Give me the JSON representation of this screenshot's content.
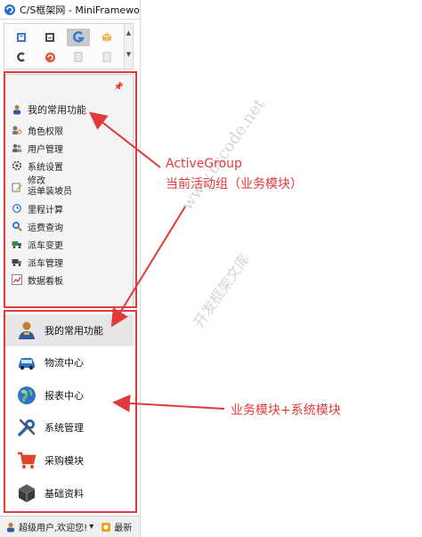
{
  "window": {
    "title": "C/S框架网 - MiniFramewo"
  },
  "toolbar": {
    "row1": [
      "doc-icon",
      "doc-icon",
      "g-logo-icon",
      "box-icon"
    ],
    "row2": [
      "c-logo-icon",
      "red-circle-icon",
      "page-icon",
      "page-icon"
    ],
    "scroll_up": "▲",
    "scroll_down": "▼"
  },
  "active_group": {
    "pin": "📌",
    "title": "我的常用功能",
    "items": [
      {
        "label": "角色权限",
        "icon": "key-user-icon"
      },
      {
        "label": "用户管理",
        "icon": "users-icon"
      },
      {
        "label": "系统设置",
        "icon": "gear-icon"
      },
      {
        "label_line1": "修改",
        "label_line2": "运单装坡员",
        "icon": "edit-icon"
      },
      {
        "label": "里程计算",
        "icon": "clock-icon"
      },
      {
        "label": "运费查询",
        "icon": "search-icon"
      },
      {
        "label": "派车变更",
        "icon": "truck-icon"
      },
      {
        "label": "派车管理",
        "icon": "truck-icon"
      },
      {
        "label": "数据看板",
        "icon": "chart-icon"
      }
    ]
  },
  "modules": [
    {
      "label": "我的常用功能",
      "icon": "user-icon",
      "selected": true
    },
    {
      "label": "物流中心",
      "icon": "car-icon",
      "selected": false
    },
    {
      "label": "报表中心",
      "icon": "globe-icon",
      "selected": false
    },
    {
      "label": "系统管理",
      "icon": "tools-icon",
      "selected": false
    },
    {
      "label": "采购模块",
      "icon": "cart-icon",
      "selected": false
    },
    {
      "label": "基础资料",
      "icon": "cube-icon",
      "selected": false
    }
  ],
  "statusbar": {
    "user_text": "超级用户,欢迎您!",
    "dropdown": "▾",
    "right_text": "最新"
  },
  "annotations": {
    "active_group_label": "ActiveGroup",
    "active_group_desc": "当前活动组（业务模块）",
    "modules_desc": "业务模块+系统模块"
  },
  "watermark": {
    "line1": "www.cscode.net",
    "line2": "开发框架文库"
  },
  "colors": {
    "annotation_red": "#e03a3a",
    "selected_bg": "#e6e6e6",
    "panel_bg": "#f4f4f4"
  }
}
